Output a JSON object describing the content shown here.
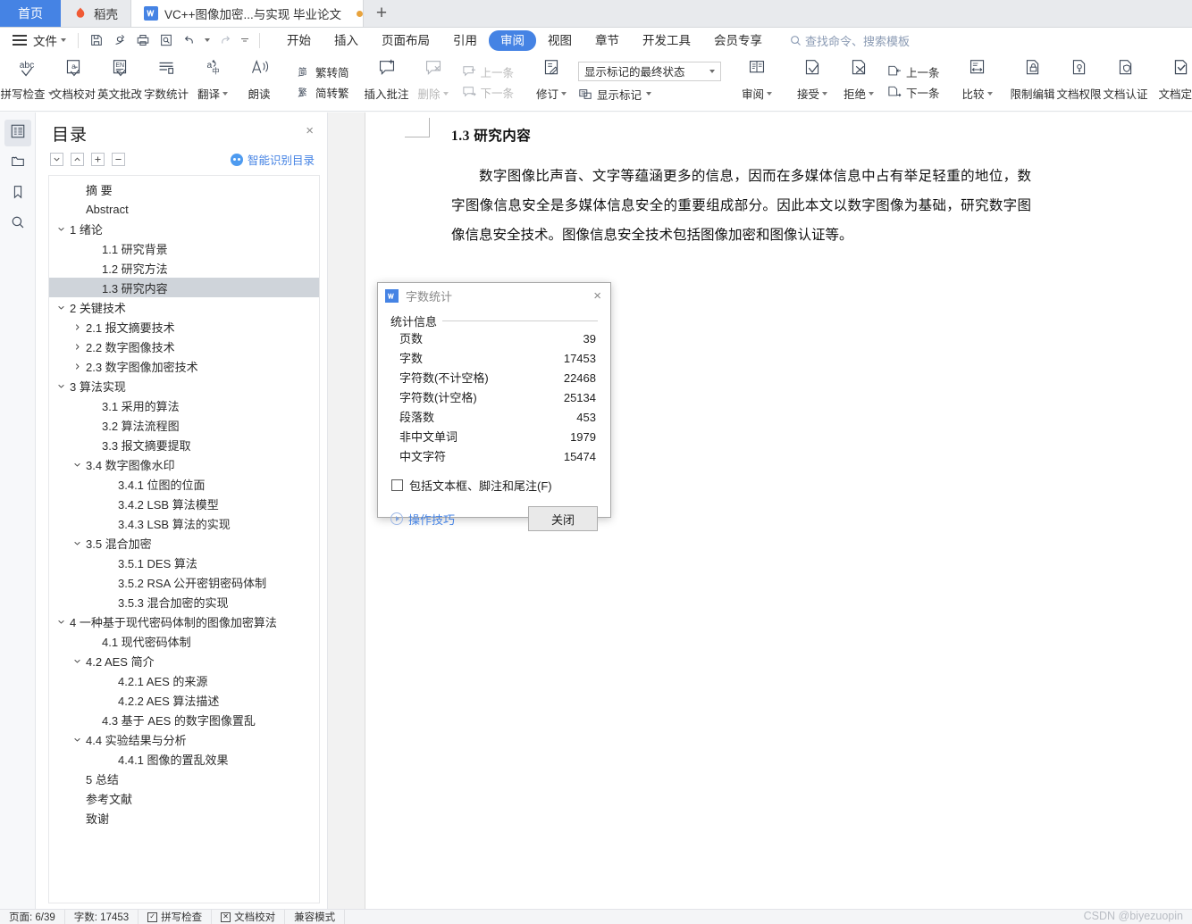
{
  "tabbar": {
    "home_label": "首页",
    "docer_label": "稻壳",
    "doc_label": "VC++图像加密...与实现 毕业论文",
    "new_tab_label": "+"
  },
  "menu": {
    "file_label": "文件",
    "quick_icons": [
      "save-icon",
      "save-as-icon",
      "print-icon",
      "print-preview-icon",
      "undo-icon",
      "redo-icon",
      "customize-icon"
    ],
    "ribbon_tabs": [
      {
        "label": "开始",
        "selected": false
      },
      {
        "label": "插入",
        "selected": false
      },
      {
        "label": "页面布局",
        "selected": false
      },
      {
        "label": "引用",
        "selected": false
      },
      {
        "label": "审阅",
        "selected": true
      },
      {
        "label": "视图",
        "selected": false
      },
      {
        "label": "章节",
        "selected": false
      },
      {
        "label": "开发工具",
        "selected": false
      },
      {
        "label": "会员专享",
        "selected": false
      }
    ],
    "search_placeholder": "查找命令、搜索模板"
  },
  "ribbon": {
    "group1": [
      {
        "label": "拼写检查",
        "icon": "abc-check-icon",
        "dropdown": true,
        "disabled": false
      },
      {
        "label": "文档校对",
        "icon": "doc-proof-icon",
        "dropdown": false,
        "disabled": false
      },
      {
        "label": "英文批改",
        "icon": "en-correct-icon",
        "dropdown": false,
        "disabled": false
      },
      {
        "label": "字数统计",
        "icon": "word-count-icon",
        "dropdown": false,
        "disabled": false
      },
      {
        "label": "翻译",
        "icon": "translate-icon",
        "dropdown": true,
        "disabled": false
      },
      {
        "label": "朗读",
        "icon": "read-aloud-icon",
        "dropdown": false,
        "disabled": false
      }
    ],
    "convert": [
      {
        "label": "繁转简",
        "icon": "trad-to-simp-icon"
      },
      {
        "label": "简转繁",
        "icon": "simp-to-trad-icon"
      }
    ],
    "comments": [
      {
        "label": "插入批注",
        "icon": "insert-comment-icon",
        "dropdown": false,
        "disabled": false
      },
      {
        "label": "删除",
        "icon": "delete-comment-icon",
        "dropdown": true,
        "disabled": true
      }
    ],
    "comment_nav": [
      {
        "label": "上一条",
        "icon": "prev-comment-icon",
        "disabled": true
      },
      {
        "label": "下一条",
        "icon": "next-comment-icon",
        "disabled": true
      }
    ],
    "revision": {
      "label": "修订",
      "icon": "track-changes-icon",
      "display_select_value": "显示标记的最终状态",
      "show_marks_label": "显示标记",
      "show_marks_icon": "show-markup-icon"
    },
    "review_pane": {
      "label": "审阅",
      "icon": "review-pane-icon",
      "dropdown": true
    },
    "accept_reject": [
      {
        "label": "接受",
        "icon": "accept-icon",
        "dropdown": true
      },
      {
        "label": "拒绝",
        "icon": "reject-icon",
        "dropdown": true
      }
    ],
    "change_nav": [
      {
        "label": "上一条",
        "icon": "prev-change-icon"
      },
      {
        "label": "下一条",
        "icon": "next-change-icon"
      }
    ],
    "compare": {
      "label": "比较",
      "icon": "compare-icon",
      "dropdown": true
    },
    "protect": [
      {
        "label": "限制编辑",
        "icon": "restrict-edit-icon"
      },
      {
        "label": "文档权限",
        "icon": "doc-permission-icon"
      },
      {
        "label": "文档认证",
        "icon": "doc-certify-icon"
      },
      {
        "label": "文档定稿",
        "icon": "doc-finalize-icon"
      }
    ]
  },
  "rail": [
    {
      "name": "outline-icon",
      "selected": true
    },
    {
      "name": "folder-icon",
      "selected": false
    },
    {
      "name": "bookmark-icon",
      "selected": false
    },
    {
      "name": "search-icon",
      "selected": false
    }
  ],
  "toc": {
    "title": "目录",
    "close_label": "×",
    "tool_buttons": [
      "collapse-down-icon",
      "collapse-up-icon",
      "expand-all-icon",
      "collapse-all-icon"
    ],
    "smart_label": "智能识别目录",
    "items": [
      {
        "text": "摘 要",
        "indent": 1,
        "chev": "",
        "selected": false
      },
      {
        "text": "Abstract",
        "indent": 1,
        "chev": "",
        "selected": false
      },
      {
        "text": "1 绪论",
        "indent": 0,
        "chev": "down",
        "selected": false
      },
      {
        "text": "1.1 研究背景",
        "indent": 2,
        "chev": "",
        "selected": false
      },
      {
        "text": "1.2 研究方法",
        "indent": 2,
        "chev": "",
        "selected": false
      },
      {
        "text": "1.3 研究内容",
        "indent": 2,
        "chev": "",
        "selected": true
      },
      {
        "text": "2 关键技术",
        "indent": 0,
        "chev": "down",
        "selected": false
      },
      {
        "text": "2.1 报文摘要技术",
        "indent": 1,
        "chev": "right",
        "selected": false
      },
      {
        "text": "2.2 数字图像技术",
        "indent": 1,
        "chev": "right",
        "selected": false
      },
      {
        "text": "2.3 数字图像加密技术",
        "indent": 1,
        "chev": "right",
        "selected": false
      },
      {
        "text": "3 算法实现",
        "indent": 0,
        "chev": "down",
        "selected": false
      },
      {
        "text": "3.1 采用的算法",
        "indent": 2,
        "chev": "",
        "selected": false
      },
      {
        "text": "3.2 算法流程图",
        "indent": 2,
        "chev": "",
        "selected": false
      },
      {
        "text": "3.3 报文摘要提取",
        "indent": 2,
        "chev": "",
        "selected": false
      },
      {
        "text": "3.4 数字图像水印",
        "indent": 1,
        "chev": "down",
        "selected": false
      },
      {
        "text": "3.4.1 位图的位面",
        "indent": 3,
        "chev": "",
        "selected": false
      },
      {
        "text": "3.4.2 LSB 算法模型",
        "indent": 3,
        "chev": "",
        "selected": false
      },
      {
        "text": "3.4.3 LSB 算法的实现",
        "indent": 3,
        "chev": "",
        "selected": false
      },
      {
        "text": "3.5 混合加密",
        "indent": 1,
        "chev": "down",
        "selected": false
      },
      {
        "text": "3.5.1 DES 算法",
        "indent": 3,
        "chev": "",
        "selected": false
      },
      {
        "text": "3.5.2 RSA 公开密钥密码体制",
        "indent": 3,
        "chev": "",
        "selected": false
      },
      {
        "text": "3.5.3 混合加密的实现",
        "indent": 3,
        "chev": "",
        "selected": false
      },
      {
        "text": "4 一种基于现代密码体制的图像加密算法",
        "indent": 0,
        "chev": "down",
        "selected": false
      },
      {
        "text": "4.1 现代密码体制",
        "indent": 2,
        "chev": "",
        "selected": false
      },
      {
        "text": "4.2 AES 简介",
        "indent": 1,
        "chev": "down",
        "selected": false
      },
      {
        "text": "4.2.1 AES 的来源",
        "indent": 3,
        "chev": "",
        "selected": false
      },
      {
        "text": "4.2.2 AES 算法描述",
        "indent": 3,
        "chev": "",
        "selected": false
      },
      {
        "text": "4.3 基于 AES 的数字图像置乱",
        "indent": 2,
        "chev": "",
        "selected": false
      },
      {
        "text": "4.4 实验结果与分析",
        "indent": 1,
        "chev": "down",
        "selected": false
      },
      {
        "text": "4.4.1 图像的置乱效果",
        "indent": 3,
        "chev": "",
        "selected": false
      },
      {
        "text": "5 总结",
        "indent": 1,
        "chev": "",
        "selected": false
      },
      {
        "text": "参考文献",
        "indent": 1,
        "chev": "",
        "selected": false
      },
      {
        "text": "致谢",
        "indent": 1,
        "chev": "",
        "selected": false
      }
    ]
  },
  "document": {
    "heading": "1.3 研究内容",
    "paragraph": "数字图像比声音、文字等蕴涵更多的信息，因而在多媒体信息中占有举足轻重的地位，数字图像信息安全是多媒体信息安全的重要组成部分。因此本文以数字图像为基础，研究数字图像信息安全技术。图像信息安全技术包括图像加密和图像认证等。"
  },
  "dialog": {
    "title": "字数统计",
    "close_label": "×",
    "group_label": "统计信息",
    "stats": [
      {
        "label": "页数",
        "value": "39"
      },
      {
        "label": "字数",
        "value": "17453"
      },
      {
        "label": "字符数(不计空格)",
        "value": "22468"
      },
      {
        "label": "字符数(计空格)",
        "value": "25134"
      },
      {
        "label": "段落数",
        "value": "453"
      },
      {
        "label": "非中文单词",
        "value": "1979"
      },
      {
        "label": "中文字符",
        "value": "15474"
      }
    ],
    "checkbox_label": "包括文本框、脚注和尾注(F)",
    "checkbox_checked": false,
    "tips_label": "操作技巧",
    "close_button": "关闭"
  },
  "statusbar": {
    "page": "页面: 6/39",
    "words": "字数: 17453",
    "spell": "拼写检查",
    "proof": "文档校对",
    "mode": "兼容模式",
    "watermark": "CSDN @biyezuopin"
  },
  "colors": {
    "accent": "#4583e4",
    "tab_home_bg": "#4583e4",
    "toc_selected": "#cfd4da",
    "unsaved_dot": "#e8a33d",
    "link": "#4583e4"
  }
}
